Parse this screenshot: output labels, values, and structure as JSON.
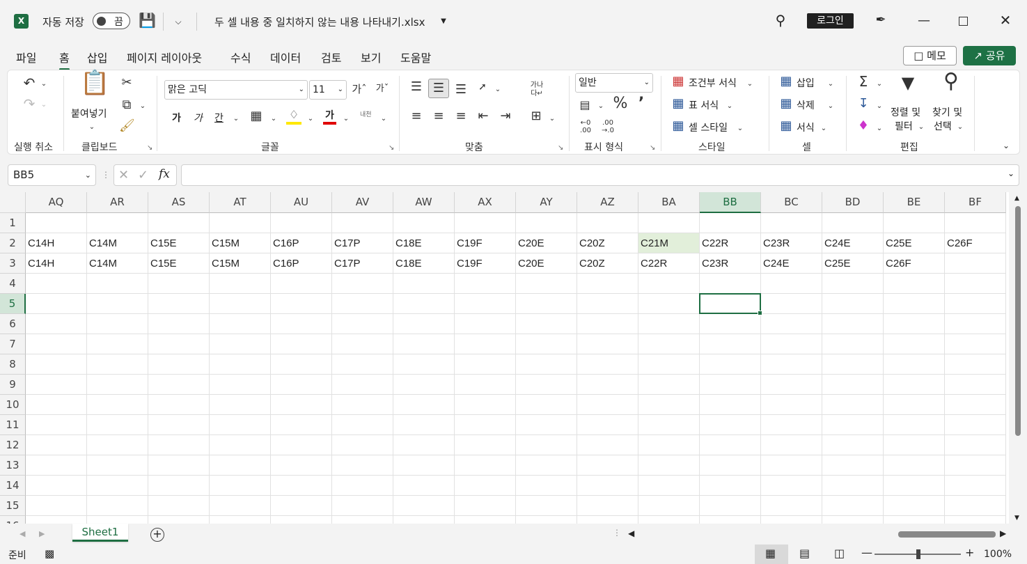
{
  "title_bar": {
    "app_icon": "X",
    "autosave_label": "자동 저장",
    "autosave_state": "끔",
    "doc_title": "두 셀 내용 중 일치하지 않는 내용 나타내기.xlsx",
    "login_label": "로그인"
  },
  "tabs": [
    "파일",
    "홈",
    "삽입",
    "페이지 레이아웃",
    "수식",
    "데이터",
    "검토",
    "보기",
    "도움말"
  ],
  "active_tab": "홈",
  "memo_label": "메모",
  "share_label": "공유",
  "ribbon": {
    "groups": {
      "undo": "실행 취소",
      "clipboard": "클립보드",
      "font": "글꼴",
      "align": "맞춤",
      "number": "표시 형식",
      "styles": "스타일",
      "cells": "셀",
      "editing": "편집"
    },
    "paste_label": "붙여넣기",
    "font_name": "맑은 고딕",
    "font_size": "11",
    "bold_label": "가",
    "italic_label": "가",
    "underline_label": "간",
    "font_color_label": "가",
    "phonetic_label": "내천",
    "number_format": "일반",
    "conditional_format": "조건부 서식",
    "table_format": "표 서식",
    "cell_style": "셀 스타일",
    "insert_label": "삽입",
    "delete_label": "삭제",
    "format_label": "서식",
    "sort_filter_1": "정렬 및",
    "sort_filter_2": "필터",
    "find_select_1": "찾기 및",
    "find_select_2": "선택"
  },
  "name_box": "BB5",
  "fx_label": "fx",
  "formula_value": "",
  "columns": [
    "AQ",
    "AR",
    "AS",
    "AT",
    "AU",
    "AV",
    "AW",
    "AX",
    "AY",
    "AZ",
    "BA",
    "BB",
    "BC",
    "BD",
    "BE",
    "BF"
  ],
  "selected_column": "BB",
  "rows": [
    "1",
    "2",
    "3",
    "4",
    "5",
    "6",
    "7",
    "8",
    "9",
    "10",
    "11",
    "12",
    "13",
    "14",
    "15",
    "16"
  ],
  "selected_row": "5",
  "row2": [
    "C14H",
    "C14M",
    "C15E",
    "C15M",
    "C16P",
    "C17P",
    "C18E",
    "C19F",
    "C20E",
    "C20Z",
    "C21M",
    "C22R",
    "C23R",
    "C24E",
    "C25E",
    "C26F"
  ],
  "row3": [
    "C14H",
    "C14M",
    "C15E",
    "C15M",
    "C16P",
    "C17P",
    "C18E",
    "C19F",
    "C20E",
    "C20Z",
    "C22R",
    "C23R",
    "C24E",
    "C25E",
    "C26F",
    ""
  ],
  "highlight_color": "#e2efda",
  "accent_color": "#1e6e42",
  "sheet_tab": "Sheet1",
  "status_text": "준비",
  "zoom": "100%"
}
